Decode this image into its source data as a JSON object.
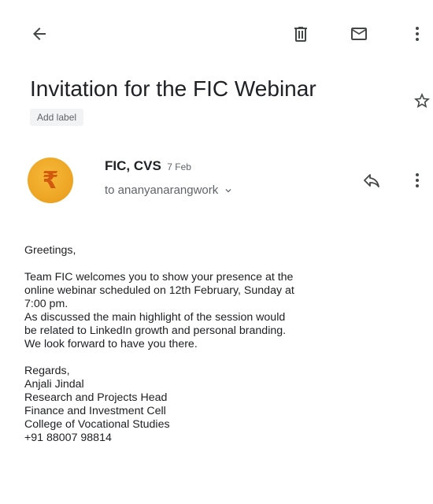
{
  "icons": {
    "back": "arrow-left",
    "delete": "trash",
    "mark_unread": "envelope",
    "more": "vertical-dots",
    "star": "star-outline",
    "reply": "reply-arrow",
    "expand": "chevron-down"
  },
  "message": {
    "subject": "Invitation for the FIC Webinar",
    "add_label": "Add label",
    "sender_name": "FIC, CVS",
    "sender_avatar_char": "₹",
    "date": "7 Feb",
    "recipient_line": "to ananyanarangwork",
    "body": {
      "greeting": "Greetings,",
      "paragraph_lines": [
        "Team FIC welcomes you to show your presence at the",
        "online webinar scheduled on 12th February, Sunday at",
        "7:00 pm.",
        "As discussed the main highlight of the session would",
        "be related to LinkedIn growth and personal branding.",
        "We look forward to have you there."
      ],
      "signature_lines": [
        "Regards,",
        "Anjali Jindal",
        "Research and Projects Head",
        "Finance and Investment Cell",
        "College of Vocational Studies",
        "+91 88007 98814"
      ]
    }
  },
  "colors": {
    "avatar_bg": "#eda322",
    "avatar_glyph": "#d25a0e",
    "icon": "#444746",
    "secondary_text": "#5f6368"
  }
}
